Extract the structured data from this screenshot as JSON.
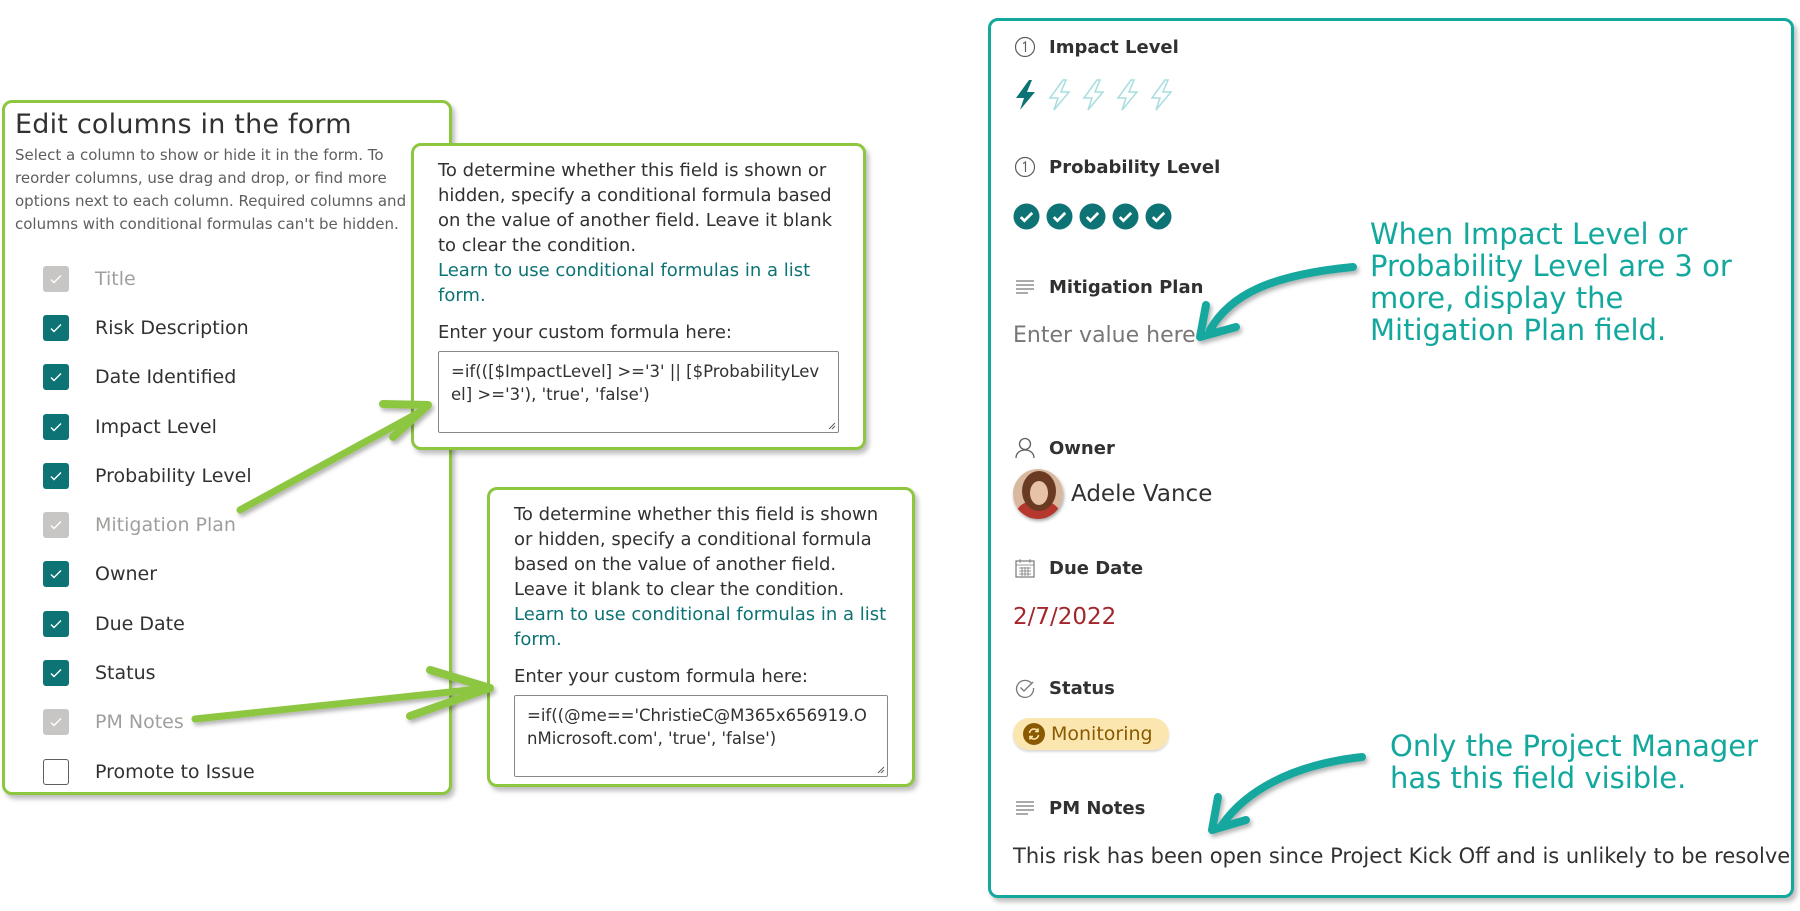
{
  "edit_columns": {
    "title": "Edit columns in the form",
    "description": "Select a column to show or hide it in the form. To reorder columns, use drag and drop, or find more options next to each column. Required columns and columns with conditional formulas can't be hidden.",
    "columns": [
      {
        "label": "Title",
        "state": "disabled-checked"
      },
      {
        "label": "Risk Description",
        "state": "checked"
      },
      {
        "label": "Date Identified",
        "state": "checked"
      },
      {
        "label": "Impact Level",
        "state": "checked"
      },
      {
        "label": "Probability Level",
        "state": "checked"
      },
      {
        "label": "Mitigation Plan",
        "state": "disabled-checked"
      },
      {
        "label": "Owner",
        "state": "checked"
      },
      {
        "label": "Due Date",
        "state": "checked"
      },
      {
        "label": "Status",
        "state": "checked"
      },
      {
        "label": "PM Notes",
        "state": "disabled-checked"
      },
      {
        "label": "Promote to Issue",
        "state": "unchecked"
      }
    ]
  },
  "formula_popups": [
    {
      "instructions": "To determine whether this field is shown or hidden, specify a conditional formula based on the value of another field. Leave it blank to clear the condition.",
      "link": "Learn to use conditional formulas in a list form.",
      "formula_label": "Enter your custom formula here:",
      "formula": "=if(([$ImpactLevel] >='3' || [$ProbabilityLevel] >='3'), 'true', 'false')"
    },
    {
      "instructions": "To determine whether this field is shown or hidden, specify a conditional formula based on the value of another field. Leave it blank to clear the condition.",
      "link": "Learn to use conditional formulas in a list form.",
      "formula_label": "Enter your custom formula here:",
      "formula": "=if((@me=='ChristieC@M365x656919.OnMicrosoft.com', 'true', 'false')"
    }
  ],
  "form": {
    "impact_level": {
      "label": "Impact Level",
      "icon": "number-one-circle-icon",
      "rating": 1,
      "max": 5
    },
    "probability_level": {
      "label": "Probability Level",
      "icon": "number-one-circle-icon",
      "rating": 5,
      "max": 5
    },
    "mitigation_plan": {
      "label": "Mitigation Plan",
      "icon": "multiline-text-icon",
      "placeholder": "Enter value here"
    },
    "owner": {
      "label": "Owner",
      "icon": "person-icon",
      "name": "Adele Vance"
    },
    "due_date": {
      "label": "Due Date",
      "icon": "calendar-icon",
      "value": "2/7/2022"
    },
    "status": {
      "label": "Status",
      "icon": "check-circle-icon",
      "value": "Monitoring"
    },
    "pm_notes": {
      "label": "PM Notes",
      "icon": "multiline-text-icon",
      "value": "This risk has been open since Project Kick Off and is unlikely to be resolved unt"
    }
  },
  "callouts": {
    "mitigation": "When Impact Level or Probability Level are 3 or more, display the Mitigation Plan field.",
    "pm_notes": "Only the Project Manager has this field visible."
  },
  "colors": {
    "accent_teal": "#0e7374",
    "callout_teal": "#13a89e",
    "annotation_green": "#8dc63f",
    "due_date_red": "#a4262c",
    "status_bg": "#fce6b0"
  }
}
